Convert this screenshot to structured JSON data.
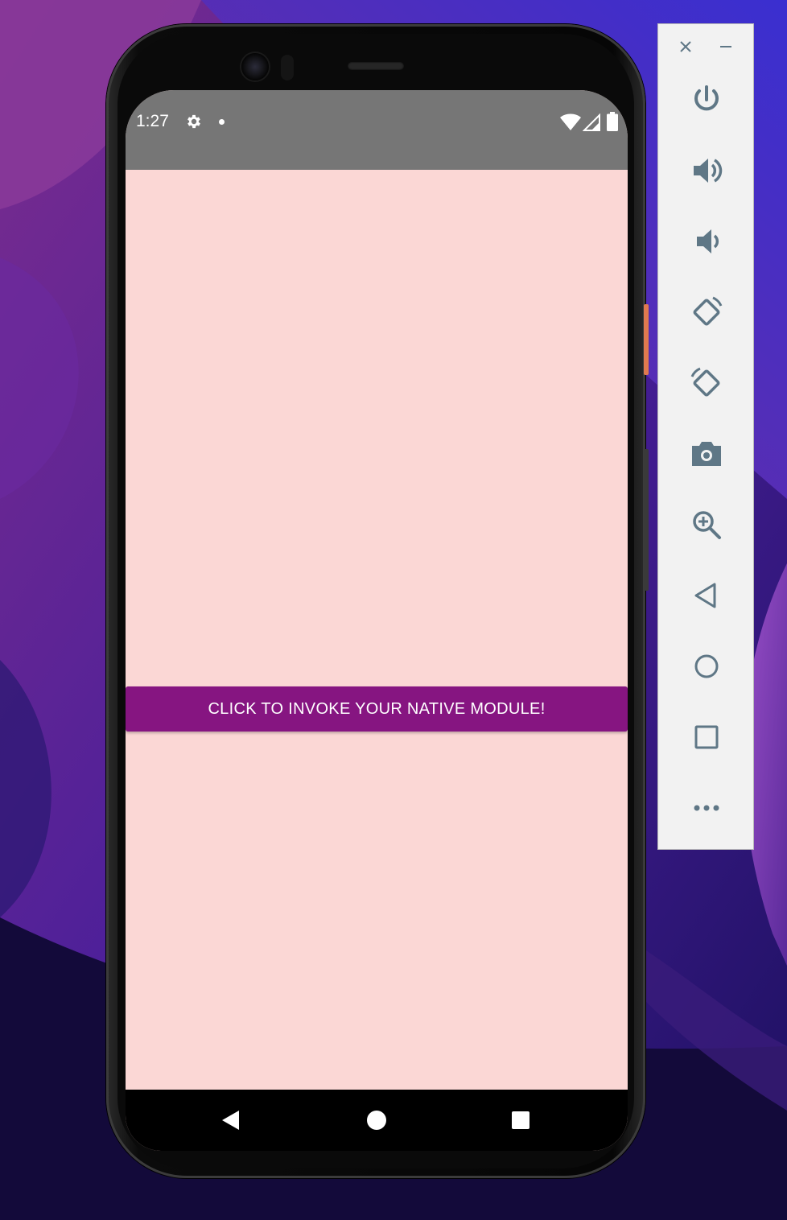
{
  "status_bar": {
    "time": "1:27",
    "icons": [
      "settings-icon",
      "notification-dot",
      "wifi-icon",
      "signal-icon",
      "battery-icon"
    ]
  },
  "app": {
    "background_color": "#fbd7d5",
    "button_label": "CLICK TO INVOKE YOUR NATIVE MODULE!",
    "button_color": "#861581"
  },
  "navigation_bar": {
    "buttons": [
      "back-icon",
      "home-icon",
      "recents-icon"
    ]
  },
  "emulator_toolbar": {
    "window_controls": [
      "close-icon",
      "minimize-icon"
    ],
    "buttons": [
      "power-icon",
      "volume-up-icon",
      "volume-down-icon",
      "rotate-left-icon",
      "rotate-right-icon",
      "camera-icon",
      "zoom-icon",
      "back-icon",
      "home-icon",
      "overview-icon",
      "more-icon"
    ],
    "icon_color": "#5f7786"
  }
}
